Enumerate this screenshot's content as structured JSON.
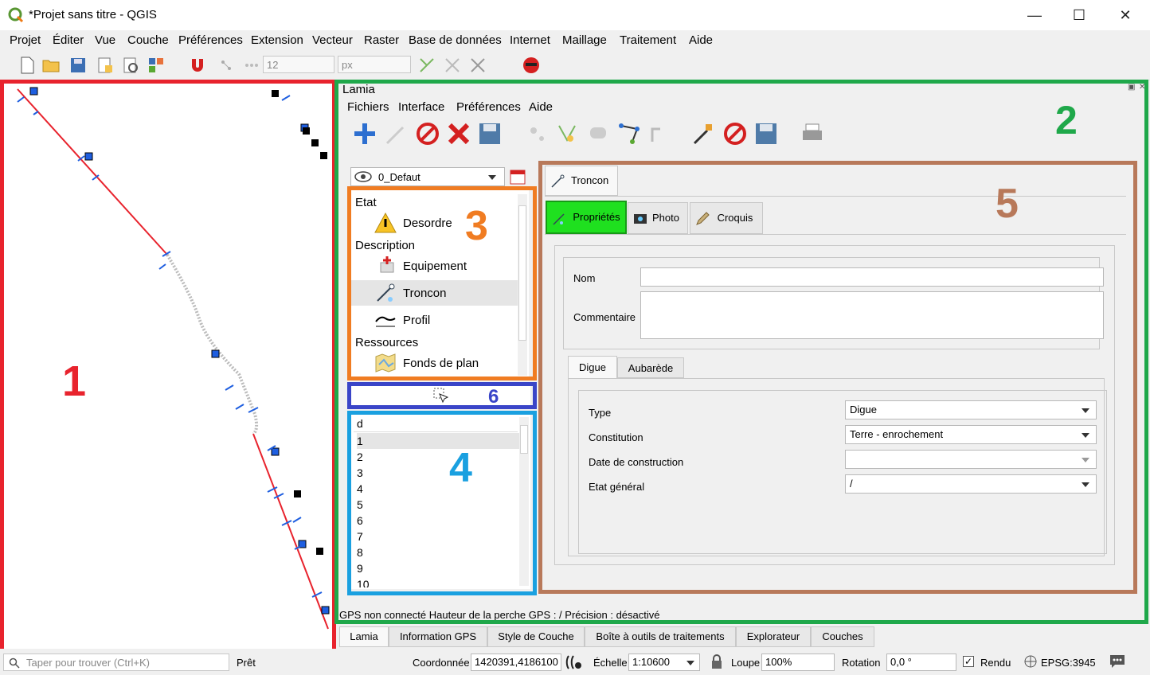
{
  "window": {
    "title": "*Projet sans titre - QGIS",
    "minimize": "—",
    "maximize": "☐",
    "close": "✕"
  },
  "menubar": [
    "Projet",
    "Éditer",
    "Vue",
    "Couche",
    "Préférences",
    "Extension",
    "Vecteur",
    "Raster",
    "Base de données",
    "Internet",
    "Maillage",
    "Traitement",
    "Aide"
  ],
  "toolbar": {
    "font_size": "12",
    "unit": "px"
  },
  "annotations": {
    "map": "1",
    "lamia": "2",
    "tree": "3",
    "list": "4",
    "form": "5",
    "selector": "6"
  },
  "annotation_colors": {
    "map": "#e8232d",
    "lamia": "#1fa84a",
    "tree": "#f07c22",
    "list": "#1aa0e0",
    "form": "#b8795a",
    "selector": "#3a45c8"
  },
  "lamia": {
    "title": "Lamia",
    "menu": [
      "Fichiers",
      "Interface",
      "Préférences",
      "Aide"
    ],
    "view_select": "0_Defaut",
    "tree": {
      "cat_etat": "Etat",
      "desordre": "Desordre",
      "cat_description": "Description",
      "equipement": "Equipement",
      "troncon": "Troncon",
      "profil": "Profil",
      "cat_ressources": "Ressources",
      "fonds": "Fonds de plan"
    },
    "list_header": "d",
    "list_items": [
      "1",
      "2",
      "3",
      "4",
      "5",
      "6",
      "7",
      "8",
      "9",
      "10"
    ],
    "form": {
      "title_tab": "Troncon",
      "tabs": [
        "Propriétés",
        "Photo",
        "Croquis"
      ],
      "nom_label": "Nom",
      "nom_value": "",
      "commentaire_label": "Commentaire",
      "commentaire_value": "",
      "subtabs": [
        "Digue",
        "Aubarède"
      ],
      "type_label": "Type",
      "type_value": "Digue",
      "constitution_label": "Constitution",
      "constitution_value": "Terre - enrochement",
      "date_label": "Date de construction",
      "date_value": "",
      "etat_label": "Etat général",
      "etat_value": "/"
    },
    "gps_status": "GPS non connecté  Hauteur de la perche GPS : /  Précision : désactivé"
  },
  "bottom_tabs": [
    "Lamia",
    "Information GPS",
    "Style de Couche",
    "Boîte à outils de traitements",
    "Explorateur",
    "Couches"
  ],
  "statusbar": {
    "search_placeholder": "Taper pour trouver (Ctrl+K)",
    "ready": "Prêt",
    "coord_label": "Coordonnée",
    "coord_value": "1420391,4186100",
    "scale_label": "Échelle",
    "scale_value": "1:10600",
    "magnifier_label": "Loupe",
    "magnifier_value": "100%",
    "rotation_label": "Rotation",
    "rotation_value": "0,0 °",
    "render_label": "Rendu",
    "crs": "EPSG:3945"
  }
}
